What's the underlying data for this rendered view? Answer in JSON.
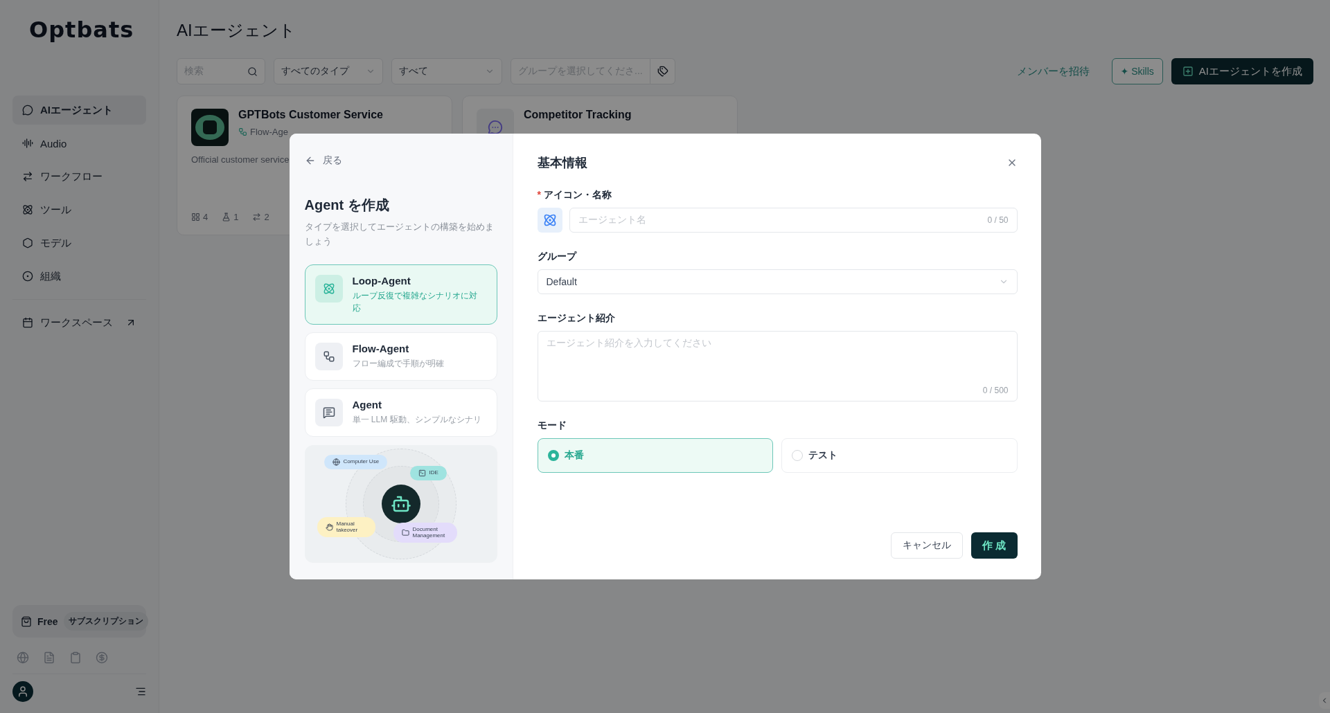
{
  "sidebar": {
    "logo": "Optbats",
    "nav": [
      {
        "label": "AIエージェント",
        "selected": true
      },
      {
        "label": "Audio",
        "selected": false
      },
      {
        "label": "ワークフロー",
        "selected": false
      },
      {
        "label": "ツール",
        "selected": false
      },
      {
        "label": "モデル",
        "selected": false
      },
      {
        "label": "組織",
        "selected": false
      }
    ],
    "workspace": {
      "label": "ワークスペース"
    },
    "plan": {
      "tier": "Free",
      "action": "サブスクリプション"
    }
  },
  "page": {
    "title": "AIエージェント",
    "filters": {
      "search": {
        "placeholder": "検索"
      },
      "type_select": {
        "value": "すべてのタイプ"
      },
      "status_select": {
        "value": "すべて"
      },
      "group_select": {
        "placeholder": "グループを選択してくださ..."
      }
    },
    "actions": {
      "invite": "メンバーを招待",
      "skills": "✦ Skills",
      "create": "AIエージェントを作成"
    }
  },
  "agents": [
    {
      "name": "GPTBots Customer Service",
      "type": "Flow-Age",
      "description": "Official customer service",
      "stats": [
        "4",
        "1",
        "2"
      ]
    },
    {
      "name": "Competitor Tracking"
    }
  ],
  "dialog": {
    "back": "戻る",
    "title": "Agent を作成",
    "subtitle": "タイプを選択してエージェントの構築を始めましょう",
    "types": [
      {
        "name": "Loop-Agent",
        "description": "ループ反復で複雑なシナリオに対応",
        "selected": true
      },
      {
        "name": "Flow-Agent",
        "description": "フロー編成で手順が明確",
        "selected": false
      },
      {
        "name": "Agent",
        "description": "単一 LLM 駆動、シンプルなシナリ",
        "selected": false
      }
    ],
    "features": [
      {
        "label": "Computer Use",
        "color": "#cfe6fb"
      },
      {
        "label": "IDE",
        "color": "#9fe3e0"
      },
      {
        "label": "Manual takeover",
        "color": "#fdf1c3"
      },
      {
        "label": "Document Management",
        "color": "#e3dcfb"
      }
    ],
    "form": {
      "title": "基本情報",
      "name_field": {
        "required_mark": "*",
        "label": "アイコン・名称",
        "placeholder": "エージェント名",
        "counter": "0 / 50"
      },
      "group_field": {
        "label": "グループ",
        "value": "Default"
      },
      "intro_field": {
        "label": "エージェント紹介",
        "placeholder": "エージェント紹介を入力してください",
        "counter": "0 / 500"
      },
      "mode": {
        "label": "モード",
        "options": [
          {
            "label": "本番",
            "selected": true
          },
          {
            "label": "テスト",
            "selected": false
          }
        ]
      },
      "buttons": {
        "cancel": "キャンセル",
        "submit": "作 成"
      }
    }
  }
}
